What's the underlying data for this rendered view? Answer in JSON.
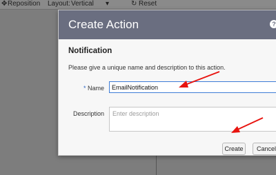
{
  "toolbar": {
    "reposition_label": "Reposition",
    "layout_label": "Layout:",
    "layout_value": "Vertical",
    "reset_label": "Reset"
  },
  "dialog": {
    "title": "Create Action",
    "help_icon": "?",
    "section_title": "Notification",
    "description_text": "Please give a unique name and description to this action.",
    "name_label": "Name",
    "required_marker": "*",
    "name_value": "EmailNotification",
    "description_label": "Description",
    "description_placeholder": "Enter description",
    "create_label": "Create",
    "cancel_label": "Cancel"
  },
  "annotations": {
    "arrow_color": "#e8140f"
  },
  "colors": {
    "header_bg": "#6a6e80",
    "focus_border": "#3c7bd6"
  }
}
